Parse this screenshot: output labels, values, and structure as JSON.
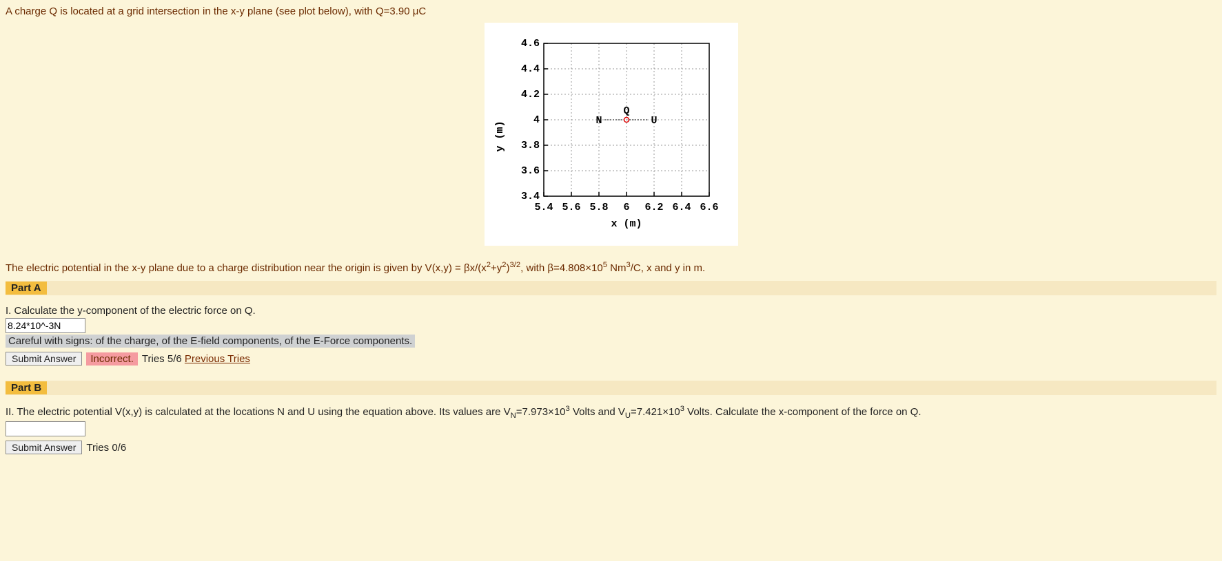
{
  "intro": "A charge Q is located at a grid intersection in the x-y plane (see plot below), with Q=3.90 μC",
  "formula_html": "The electric potential in the x-y plane due to a charge distribution near the origin is given by V(x,y) = βx/(x<sup>2</sup>+y<sup>2</sup>)<sup>3/2</sup>, with β=4.808×10<sup>5</sup> Nm<sup>3</sup>/C, x and y in m.",
  "partA": {
    "label": "Part A",
    "question": "I. Calculate the y-component of the electric force on Q.",
    "input_value": "8.24*10^-3N",
    "hint": "Careful with signs: of the charge, of the E-field components, of the E-Force components.",
    "submit": "Submit Answer",
    "status": "Incorrect.",
    "tries": "Tries 5/6",
    "prev": "Previous Tries"
  },
  "partB": {
    "label": "Part B",
    "question_html": "II. The electric potential V(x,y) is calculated at the locations N and U using the equation above. Its values are V<sub>N</sub>=7.973×10<sup>3</sup> Volts and V<sub>U</sub>=7.421×10<sup>3</sup> Volts. Calculate the x-component of the force on Q.",
    "input_value": "",
    "submit": "Submit Answer",
    "tries": "Tries 0/6"
  },
  "chart_data": {
    "type": "scatter",
    "xlabel": "x (m)",
    "ylabel": "y (m)",
    "xlim": [
      5.4,
      6.6
    ],
    "ylim": [
      3.4,
      4.6
    ],
    "xticks": [
      5.4,
      5.6,
      5.8,
      6,
      6.2,
      6.4,
      6.6
    ],
    "yticks": [
      3.4,
      3.6,
      3.8,
      4,
      4.2,
      4.4,
      4.6
    ],
    "points": [
      {
        "label": "N",
        "x": 5.8,
        "y": 4.0
      },
      {
        "label": "Q",
        "x": 6.0,
        "y": 4.0,
        "marker": "open-circle-red"
      },
      {
        "label": "U",
        "x": 6.2,
        "y": 4.0
      }
    ]
  }
}
